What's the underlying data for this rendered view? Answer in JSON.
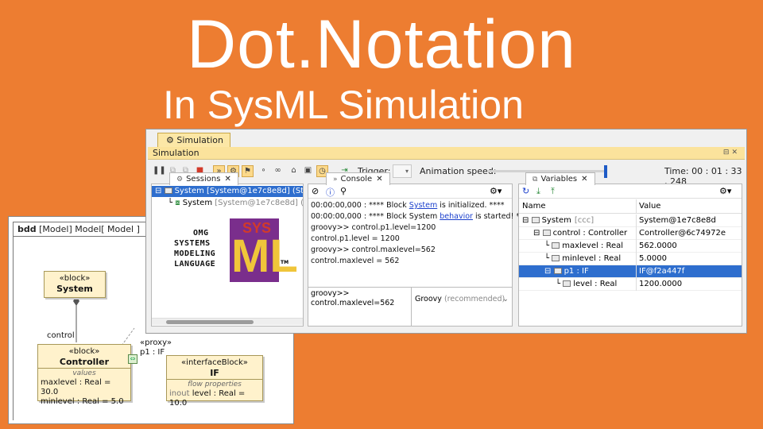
{
  "title": "Dot.Notation",
  "subtitle": "In SysML Simulation",
  "bdd": {
    "header_kind": "bdd",
    "header_rest": "[Model] Model[ Model ]",
    "system_block": {
      "stereotype": "«block»",
      "name": "System"
    },
    "controller_block": {
      "stereotype": "«block»",
      "name": "Controller",
      "section": "values",
      "attrs": [
        "maxlevel : Real = 30.0",
        "minlevel : Real = 5.0"
      ]
    },
    "if_block": {
      "stereotype": "«interfaceBlock»",
      "name": "IF",
      "section": "flow properties",
      "attr_dir": "inout",
      "attr": "level : Real = 10.0"
    },
    "role_label": "control",
    "port_stereo": "«proxy»",
    "port_label": "p1 : IF"
  },
  "simulation": {
    "tab_label": "Simulation",
    "title": "Simulation",
    "trigger_label": "Trigger:",
    "animation_label": "Animation speed:",
    "time": "Time: 00 : 01 : 33 , 248",
    "sessions": {
      "tab": "Sessions",
      "rows": [
        {
          "name": "System [System@1e7c8e8d] (Started",
          "sub": ""
        },
        {
          "name": "System",
          "sub": "[System@1e7c8e8d] (Sta"
        }
      ],
      "logo": {
        "line1": "OMG",
        "line2": "SYSTEMS",
        "line3": "MODELING",
        "line4": "LANGUAGE",
        "mark": "ML",
        "sys": "SYS",
        "tm": "TM"
      }
    },
    "console": {
      "tab": "Console",
      "lines": [
        {
          "pre": "00:00:00,000 : **** Block ",
          "link": "System",
          "post": " is initialized. ****"
        },
        {
          "pre": "00:00:00,000 : **** Block System ",
          "link": "behavior",
          "post": " is started! ****"
        },
        {
          "pre": "groovy>> control.p1.level=1200",
          "link": "",
          "post": ""
        },
        {
          "pre": "control.p1.level = 1200",
          "link": "",
          "post": ""
        },
        {
          "pre": "groovy>> control.maxlevel=562",
          "link": "",
          "post": ""
        },
        {
          "pre": "control.maxlevel = 562",
          "link": "",
          "post": ""
        }
      ],
      "input_line1": "groovy>>",
      "input_line2": "control.maxlevel=562",
      "language": "Groovy",
      "language_note": "(recommended)"
    },
    "variables": {
      "tab": "Variables",
      "col_name": "Name",
      "col_value": "Value",
      "rows": [
        {
          "name": "System",
          "extra": "[ccc]",
          "value": "System@1e7c8e8d",
          "indent": 0,
          "selected": false
        },
        {
          "name": "control : Controller",
          "extra": "",
          "value": "Controller@6c74972e",
          "indent": 1,
          "selected": false
        },
        {
          "name": "maxlevel : Real",
          "extra": "",
          "value": "562.0000",
          "indent": 2,
          "selected": false
        },
        {
          "name": "minlevel : Real",
          "extra": "",
          "value": "5.0000",
          "indent": 2,
          "selected": false
        },
        {
          "name": "p1 : IF",
          "extra": "",
          "value": "IF@f2a447f",
          "indent": 2,
          "selected": true
        },
        {
          "name": "level : Real",
          "extra": "",
          "value": "1200.0000",
          "indent": 3,
          "selected": false
        }
      ]
    }
  }
}
